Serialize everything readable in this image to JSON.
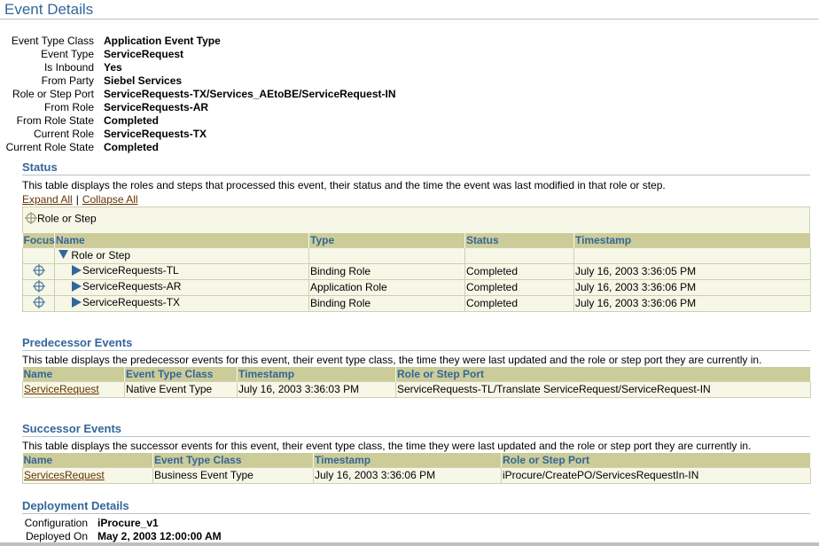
{
  "page_title": "Event Details",
  "details": [
    {
      "label": "Event Type Class",
      "value": "Application Event Type"
    },
    {
      "label": "Event Type",
      "value": "ServiceRequest"
    },
    {
      "label": "Is Inbound",
      "value": "Yes"
    },
    {
      "label": "From Party",
      "value": "Siebel Services"
    },
    {
      "label": "Role or Step Port",
      "value": "ServiceRequests-TX/Services_AEtoBE/ServiceRequest-IN"
    },
    {
      "label": "From Role",
      "value": "ServiceRequests-AR"
    },
    {
      "label": "From Role State",
      "value": "Completed"
    },
    {
      "label": "Current Role",
      "value": "ServiceRequests-TX"
    },
    {
      "label": "Current Role State",
      "value": "Completed"
    }
  ],
  "status": {
    "title": "Status",
    "description": "This table displays the roles and steps that processed this event, their status and the time the event was last modified in that role or step.",
    "expand_all": "Expand All",
    "separator": "|",
    "collapse_all": "Collapse All",
    "breadcrumb": "Role or Step",
    "headers": {
      "focus": "Focus",
      "name": "Name",
      "type": "Type",
      "status": "Status",
      "timestamp": "Timestamp"
    },
    "root_label": "Role or Step",
    "rows": [
      {
        "name": "ServiceRequests-TL",
        "type": "Binding Role",
        "status": "Completed",
        "timestamp": "July 16, 2003 3:36:05 PM"
      },
      {
        "name": "ServiceRequests-AR",
        "type": "Application Role",
        "status": "Completed",
        "timestamp": "July 16, 2003 3:36:06 PM"
      },
      {
        "name": "ServiceRequests-TX",
        "type": "Binding Role",
        "status": "Completed",
        "timestamp": "July 16, 2003 3:36:06 PM"
      }
    ]
  },
  "predecessor": {
    "title": "Predecessor Events",
    "description": "This table displays the predecessor events for this event, their event type class, the time they were last updated and the role or step port they are currently in.",
    "headers": {
      "name": "Name",
      "class": "Event Type Class",
      "timestamp": "Timestamp",
      "port": "Role or Step Port"
    },
    "rows": [
      {
        "name": "ServiceRequest",
        "class": "Native Event Type",
        "timestamp": "July 16, 2003 3:36:03 PM",
        "port": "ServiceRequests-TL/Translate ServiceRequest/ServiceRequest-IN"
      }
    ]
  },
  "successor": {
    "title": "Successor Events",
    "description": "This table displays the successor events for this event, their event type class, the time they were last updated and the role or step port they are currently in.",
    "headers": {
      "name": "Name",
      "class": "Event Type Class",
      "timestamp": "Timestamp",
      "port": "Role or Step Port"
    },
    "rows": [
      {
        "name": "ServicesRequest",
        "class": "Business Event Type",
        "timestamp": "July 16, 2003 3:36:06 PM",
        "port": "iProcure/CreatePO/ServicesRequestIn-IN"
      }
    ]
  },
  "deployment": {
    "title": "Deployment Details",
    "configuration_label": "Configuration",
    "configuration_value": "iProcure_v1",
    "deployed_on_label": "Deployed On",
    "deployed_on_value": "May 2, 2003 12:00:00 AM"
  },
  "colors": {
    "heading": "#336699",
    "header_bg": "#cccc99",
    "row_bg": "#f7f7e7",
    "link": "#663300",
    "icon": "#336699"
  },
  "icons": {
    "focus": "crosshair-icon",
    "expanded": "triangle-down-icon",
    "collapsed": "triangle-right-icon"
  }
}
